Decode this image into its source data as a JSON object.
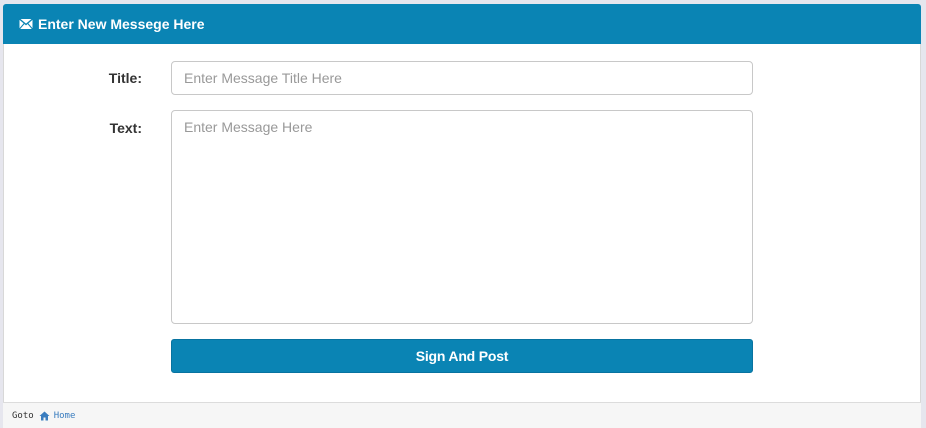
{
  "header": {
    "icon": "envelope-icon",
    "title": "Enter New Messege Here"
  },
  "form": {
    "title_label": "Title:",
    "title_placeholder": "Enter Message Title Here",
    "title_value": "",
    "text_label": "Text:",
    "text_placeholder": "Enter Message Here",
    "text_value": "",
    "submit_label": "Sign And Post"
  },
  "footer": {
    "goto_label": "Goto",
    "home_icon": "home-icon",
    "home_label": "Home"
  },
  "colors": {
    "accent": "#0a84b4",
    "link": "#3a7dbf"
  }
}
